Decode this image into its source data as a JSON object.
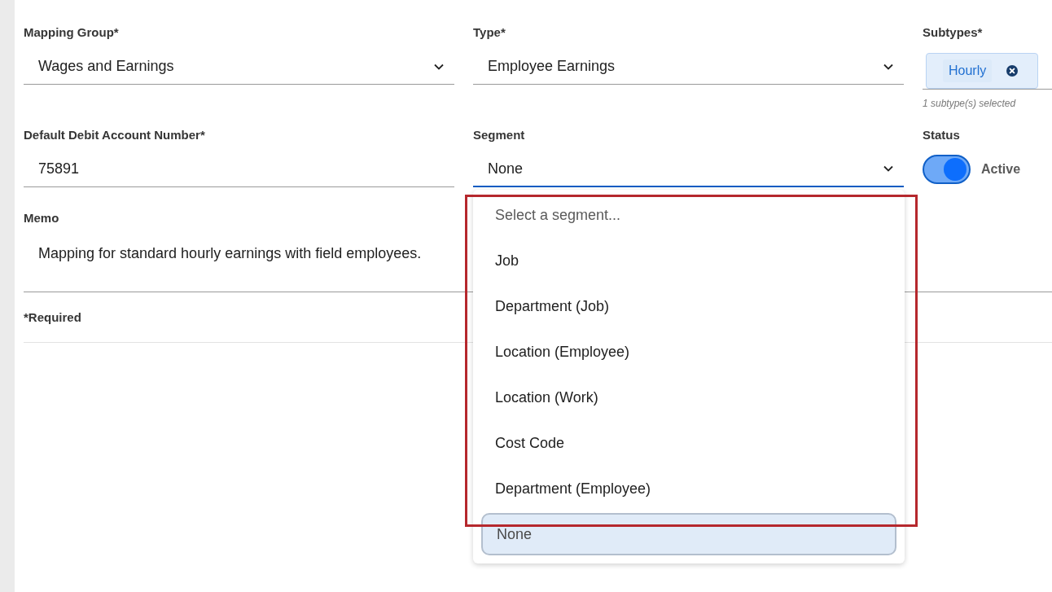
{
  "form": {
    "mapping_group": {
      "label": "Mapping Group*",
      "value": "Wages and Earnings",
      "focused": false
    },
    "type": {
      "label": "Type*",
      "value": "Employee Earnings",
      "focused": false
    },
    "subtypes": {
      "label": "Subtypes*",
      "chips": [
        {
          "label": "Hourly"
        }
      ],
      "helper": "1 subtype(s) selected"
    },
    "default_debit_account": {
      "label": "Default Debit Account Number*",
      "value": "75891",
      "focused": false
    },
    "segment": {
      "label": "Segment",
      "value": "None",
      "focused": true,
      "options": [
        {
          "label": "Select a segment...",
          "kind": "placeholder",
          "selected": false
        },
        {
          "label": "Job",
          "kind": "option",
          "selected": false
        },
        {
          "label": "Department (Job)",
          "kind": "option",
          "selected": false
        },
        {
          "label": "Location (Employee)",
          "kind": "option",
          "selected": false
        },
        {
          "label": "Location (Work)",
          "kind": "option",
          "selected": false
        },
        {
          "label": "Cost Code",
          "kind": "option",
          "selected": false
        },
        {
          "label": "Department (Employee)",
          "kind": "option",
          "selected": false
        },
        {
          "label": "None",
          "kind": "option",
          "selected": true
        }
      ]
    },
    "status": {
      "label": "Status",
      "on": true,
      "text": "Active"
    },
    "memo": {
      "label": "Memo",
      "value": "Mapping for standard hourly earnings with field employees.",
      "focused": false
    },
    "required_note": "*Required"
  }
}
